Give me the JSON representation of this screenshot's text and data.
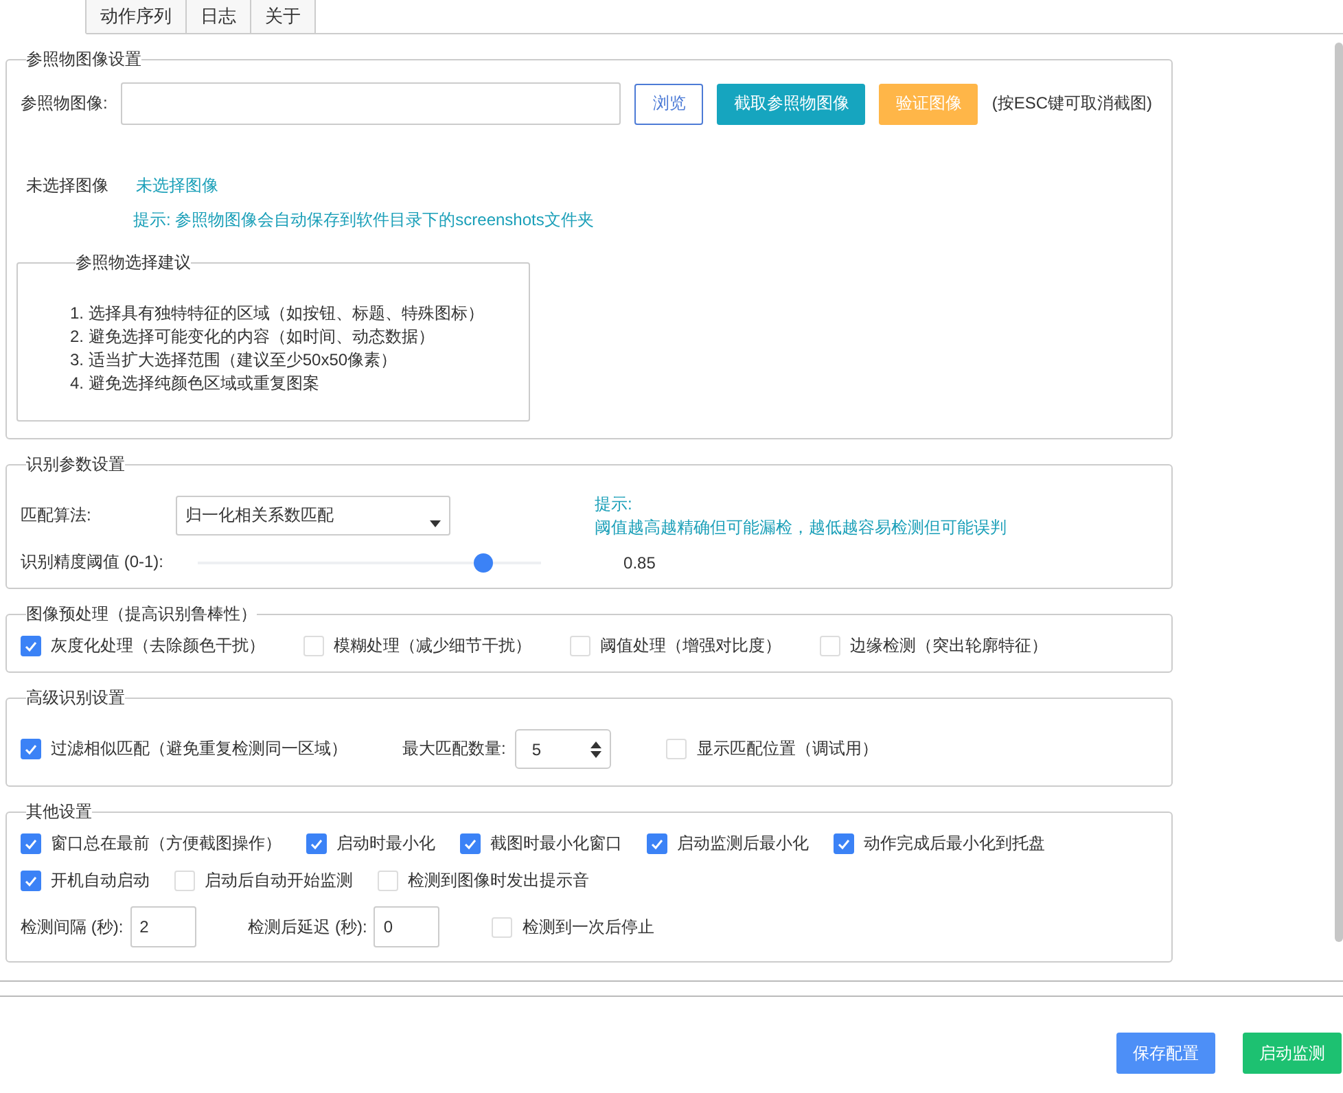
{
  "tabs": [
    {
      "selected": true
    },
    {
      "label": "动作序列",
      "selected": false
    },
    {
      "label": "日志",
      "selected": false
    },
    {
      "label": "关于",
      "selected": false
    }
  ],
  "reference": {
    "title": "参照物图像设置",
    "field_label": "参照物图像:",
    "buttons": [
      {
        "label": "浏览",
        "kind": "outline"
      },
      {
        "label": "截取参照物图像",
        "kind": "info"
      },
      {
        "label": "验证图像",
        "kind": "warning"
      }
    ],
    "esc_hint": "(按ESC键可取消截图)",
    "preview_label": "未选择图像",
    "preview_status": "未选择图像",
    "tip": "提示: 参照物图像会自动保存到软件目录下的screenshots文件夹",
    "advice": {
      "title": "参照物选择建议",
      "items": [
        "1. 选择具有独特特征的区域（如按钮、标题、特殊图标）",
        "2. 避免选择可能变化的内容（如时间、动态数据）",
        "3. 适当扩大选择范围（建议至少50x50像素）",
        "4. 避免选择纯颜色区域或重复图案"
      ]
    }
  },
  "recognition": {
    "title": "识别参数设置",
    "algorithm_label": "匹配算法:",
    "algorithm_value": "归一化相关系数匹配",
    "hint_title": "提示:",
    "hint": "阈值越高越精确但可能漏检，越低越容易检测但可能误判",
    "threshold": {
      "label": "识别精度阈值 (0-1):",
      "level": 0.85,
      "reading": "0.85"
    }
  },
  "preprocessing": {
    "title": "图像预处理（提高识别鲁棒性）",
    "options": [
      {
        "label": "灰度化处理（去除颜色干扰）",
        "checked": true
      },
      {
        "label": "模糊处理（减少细节干扰）",
        "checked": false
      },
      {
        "label": "阈值处理（增强对比度）",
        "checked": false
      },
      {
        "label": "边缘检测（突出轮廓特征）",
        "checked": false
      }
    ]
  },
  "advanced": {
    "title": "高级识别设置",
    "items": [
      {
        "kind": "checkbox",
        "label": "过滤相似匹配（避免重复检测同一区域）",
        "checked": true
      },
      {
        "kind": "spinbox",
        "label": "最大匹配数量:",
        "value": "5"
      },
      {
        "kind": "checkbox",
        "label": "显示匹配位置（调试用）",
        "checked": false
      }
    ]
  },
  "other": {
    "title": "其他设置",
    "rows": [
      [
        {
          "kind": "checkbox",
          "label": "窗口总在最前（方便截图操作）",
          "checked": true
        },
        {
          "kind": "checkbox",
          "label": "启动时最小化",
          "checked": true
        },
        {
          "kind": "checkbox",
          "label": "截图时最小化窗口",
          "checked": true
        },
        {
          "kind": "checkbox",
          "label": "启动监测后最小化",
          "checked": true
        },
        {
          "kind": "checkbox",
          "label": "动作完成后最小化到托盘",
          "checked": true
        }
      ],
      [
        {
          "kind": "checkbox",
          "label": "开机自动启动",
          "checked": true
        },
        {
          "kind": "checkbox",
          "label": "启动后自动开始监测",
          "checked": false
        },
        {
          "kind": "checkbox",
          "label": "检测到图像时发出提示音",
          "checked": false
        }
      ],
      [
        {
          "kind": "number",
          "label": "检测间隔 (秒):",
          "value": "2"
        },
        {
          "kind": "number",
          "label": "检测后延迟 (秒):",
          "value": "0"
        },
        {
          "kind": "checkbox",
          "label": "检测到一次后停止",
          "checked": false
        }
      ]
    ]
  },
  "footer_buttons": [
    {
      "label": "保存配置",
      "kind": "primary"
    },
    {
      "label": "启动监测",
      "kind": "success"
    }
  ]
}
